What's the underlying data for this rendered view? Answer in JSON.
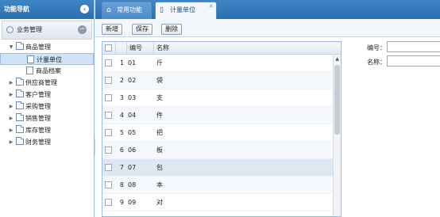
{
  "sidebar": {
    "title": "功能导航",
    "collapse_icon": "chevron-left-icon",
    "panel_title": "业务管理",
    "tree": [
      {
        "label": "商品管理",
        "expanded": true,
        "level": 0,
        "kind": "folder"
      },
      {
        "label": "计量单位",
        "level": 1,
        "kind": "file",
        "selected": true
      },
      {
        "label": "商品档案",
        "level": 1,
        "kind": "file"
      },
      {
        "label": "供应商管理",
        "level": 0,
        "kind": "folder"
      },
      {
        "label": "客户管理",
        "level": 0,
        "kind": "folder"
      },
      {
        "label": "采购管理",
        "level": 0,
        "kind": "folder"
      },
      {
        "label": "销售管理",
        "level": 0,
        "kind": "folder"
      },
      {
        "label": "库存管理",
        "level": 0,
        "kind": "folder"
      },
      {
        "label": "财务管理",
        "level": 0,
        "kind": "folder"
      }
    ]
  },
  "tabs": [
    {
      "label": "常用功能",
      "icon": "home-icon"
    },
    {
      "label": "计量单位",
      "icon": "page-icon",
      "active": true,
      "close": "×"
    }
  ],
  "toolbar": {
    "new_label": "新增",
    "save_label": "保存",
    "delete_label": "删除"
  },
  "grid": {
    "headers": {
      "code": "编号",
      "name": "名称"
    },
    "rows": [
      {
        "num": "1",
        "code": "01",
        "name": "斤"
      },
      {
        "num": "2",
        "code": "02",
        "name": "袋"
      },
      {
        "num": "3",
        "code": "03",
        "name": "支"
      },
      {
        "num": "4",
        "code": "04",
        "name": "件"
      },
      {
        "num": "5",
        "code": "05",
        "name": "把"
      },
      {
        "num": "6",
        "code": "06",
        "name": "板"
      },
      {
        "num": "7",
        "code": "07",
        "name": "包"
      },
      {
        "num": "8",
        "code": "08",
        "name": "本"
      },
      {
        "num": "9",
        "code": "09",
        "name": "对"
      }
    ],
    "selected_row": 6
  },
  "form": {
    "code_label": "编号：",
    "name_label": "名称：",
    "code_value": "",
    "name_value": ""
  }
}
